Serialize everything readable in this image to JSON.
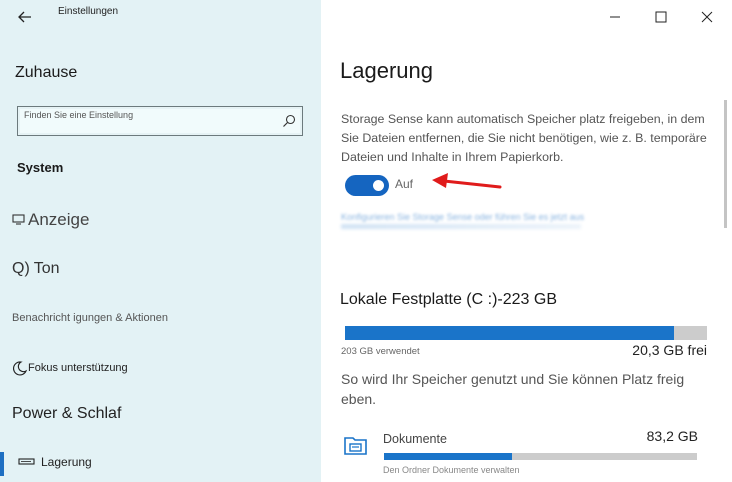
{
  "window": {
    "title": "Einstellungen"
  },
  "sidebar": {
    "home": "Zuhause",
    "search_placeholder": "Finden Sie eine Einstellung",
    "section": "System",
    "items": [
      {
        "id": "anzeige",
        "label": "Anzeige",
        "icon": "monitor-icon"
      },
      {
        "id": "ton",
        "label": "Ton",
        "icon": "speaker-icon",
        "prefix": "Q)"
      },
      {
        "id": "benachrichtigungen",
        "label": "Benachricht igungen & Aktionen",
        "icon": "notification-icon"
      },
      {
        "id": "fokus",
        "label": "Fokus unterstützung",
        "icon": "moon-icon"
      },
      {
        "id": "power",
        "label": "Power & Schlaf",
        "icon": "power-icon"
      },
      {
        "id": "lagerung",
        "label": "Lagerung",
        "icon": "drive-icon",
        "active": true
      }
    ]
  },
  "main": {
    "title": "Lagerung",
    "description": "Storage Sense kann automatisch Speicher platz freigeben, in dem Sie Dateien entfernen, die Sie nicht benötigen, wie z. B. temporäre Dateien und Inhalte in Ihrem Papierkorb.",
    "toggle": {
      "label": "Auf",
      "state": "on"
    },
    "config_link": "Konfigurieren Sie Storage Sense oder führen Sie es jetzt aus",
    "drive": {
      "title": "Lokale Festplatte (C :)-223 GB",
      "used": "203 GB verwendet",
      "free": "20,3 GB frei",
      "used_fraction": 0.91
    },
    "usage_description": "So wird Ihr Speicher genutzt und Sie können Platz freig eben.",
    "categories": [
      {
        "name": "Dokumente",
        "size": "83,2 GB",
        "sub": "Den Ordner Dokumente verwalten",
        "fraction": 0.41,
        "icon": "documents-folder-icon"
      }
    ]
  },
  "colors": {
    "accent": "#1a74c9",
    "sidebar_bg": "#e3f2f5",
    "arrow": "#e01b1b"
  }
}
